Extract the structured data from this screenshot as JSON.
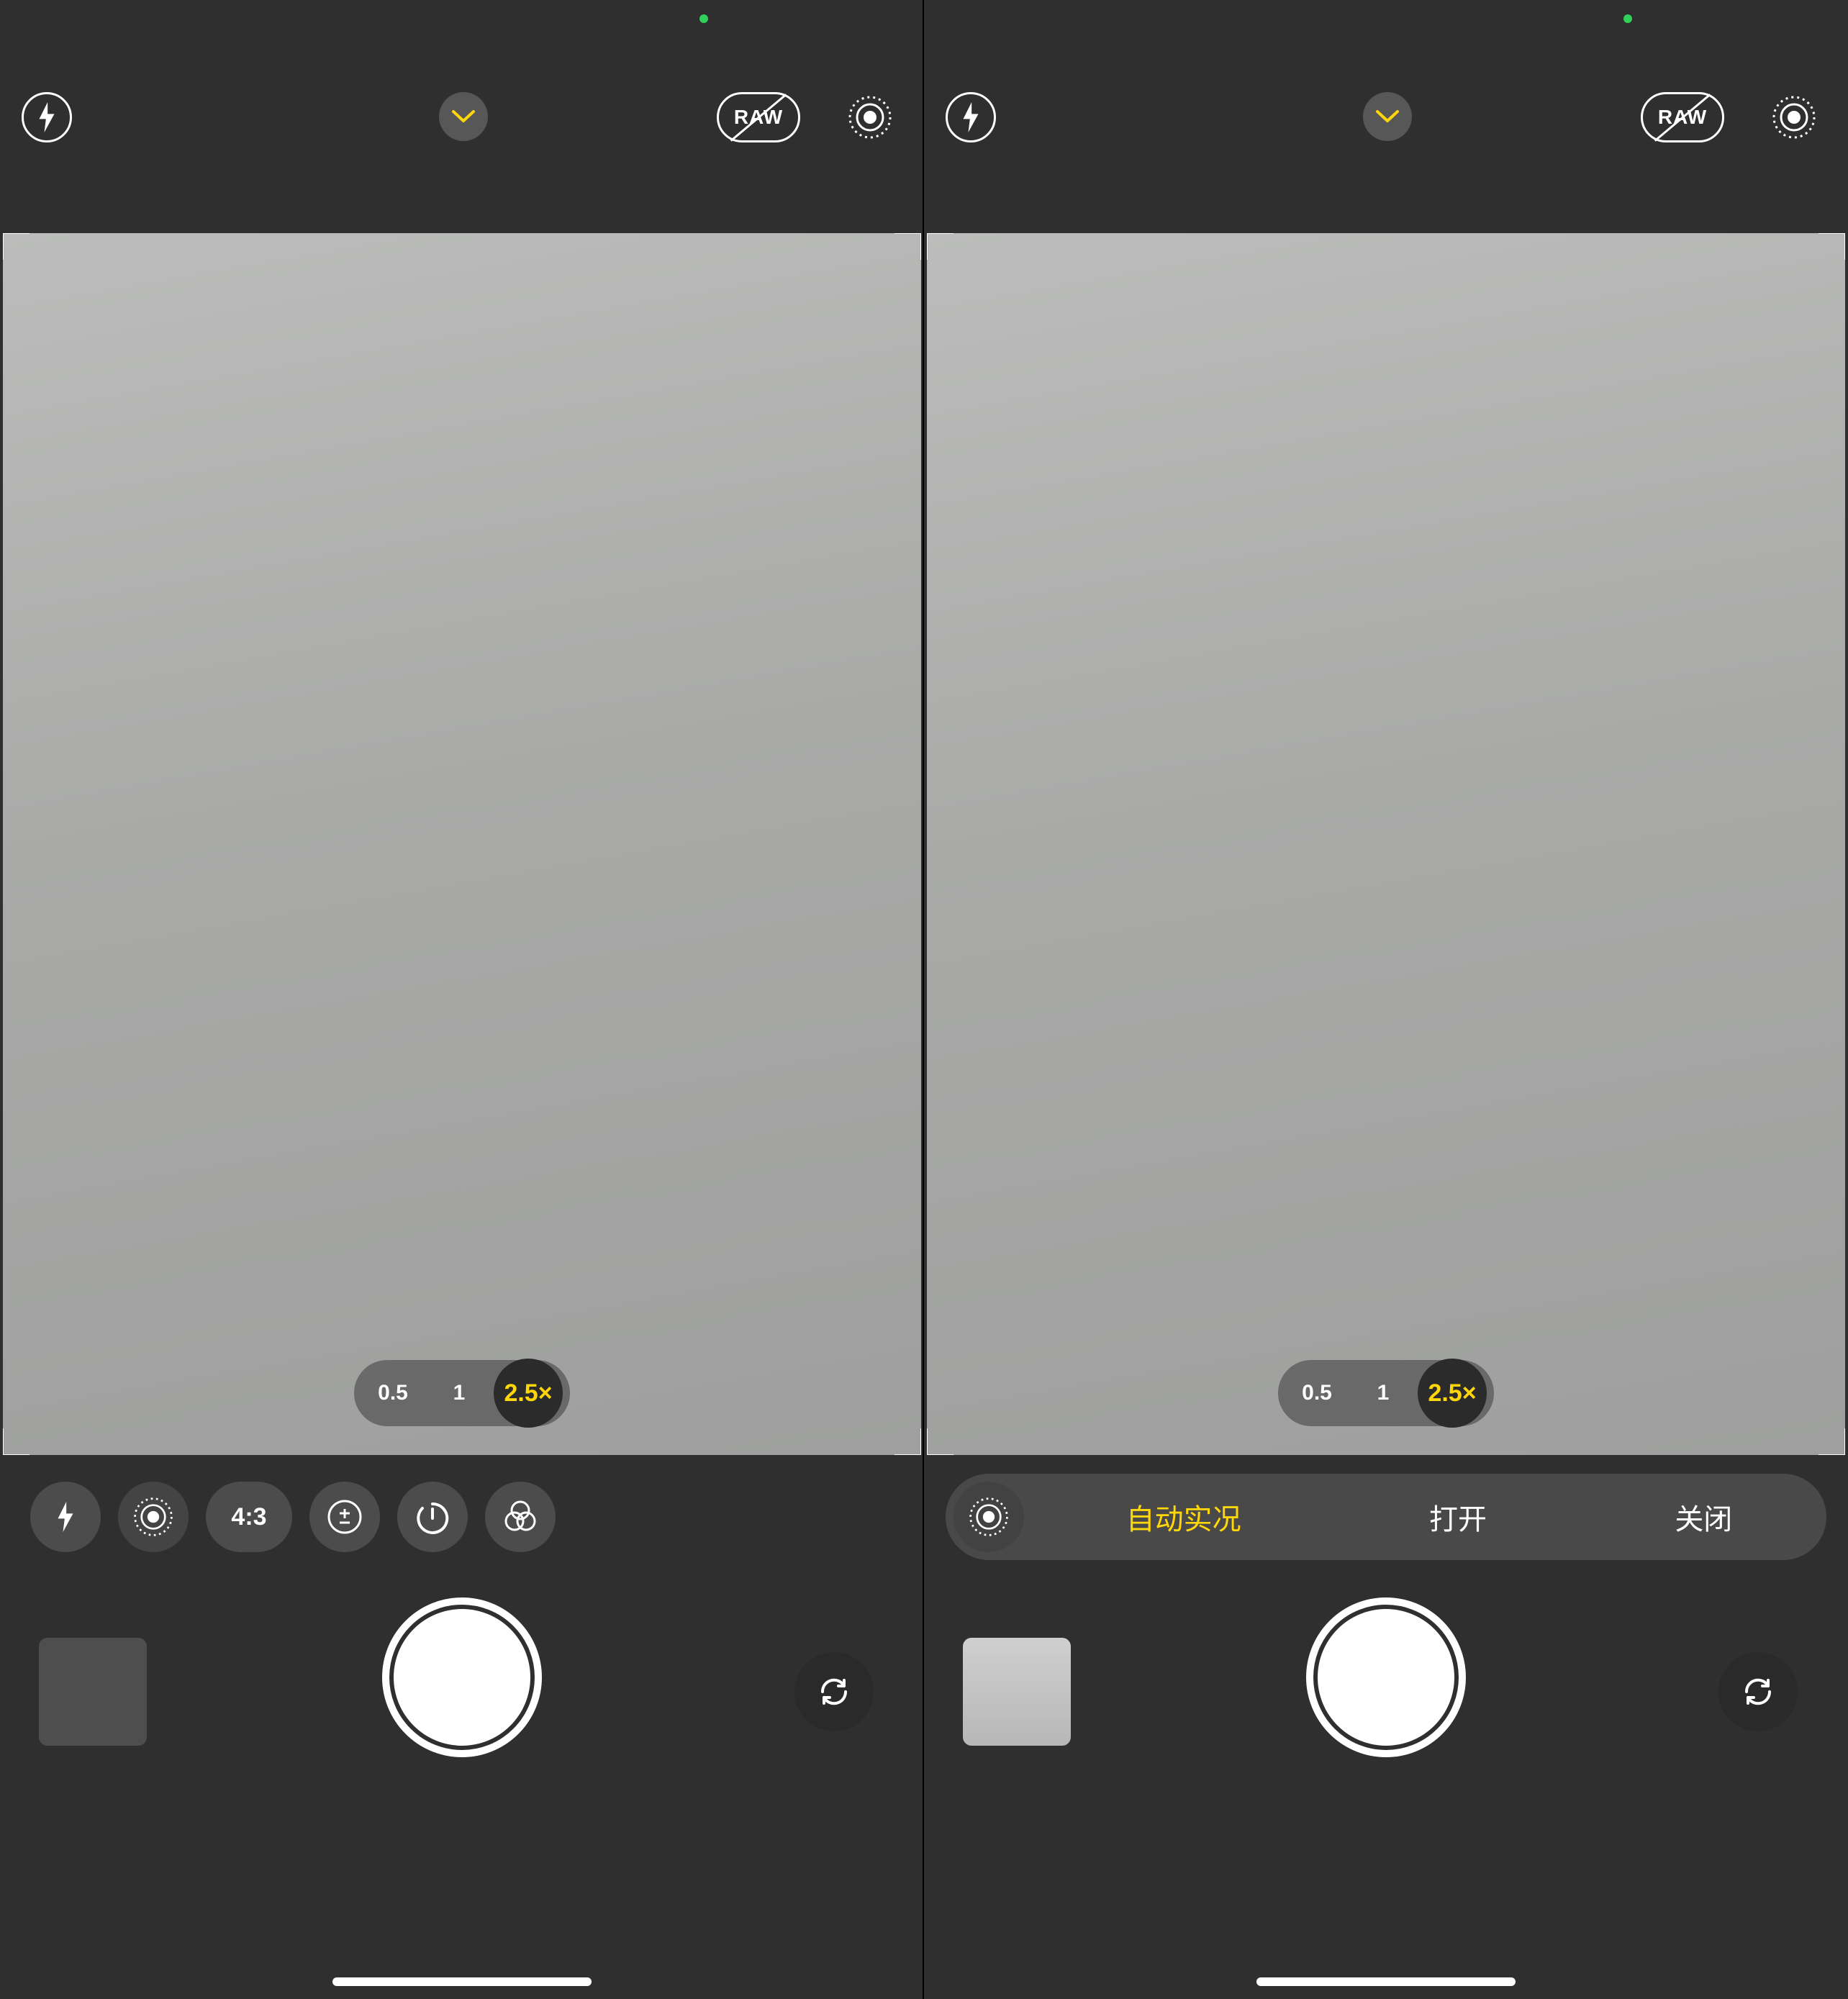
{
  "top_controls": {
    "flash": "flash",
    "raw_label": "RAW",
    "live": "live"
  },
  "zoom": {
    "options": [
      "0.5",
      "1",
      "2.5×"
    ],
    "active_index": 2
  },
  "tray_left": {
    "aspect_label": "4:3"
  },
  "tray_right": {
    "options": [
      "自动实况",
      "打开",
      "关闭"
    ],
    "active_index": 0
  },
  "colors": {
    "accent": "#ffd60a",
    "red": "#ff0000"
  }
}
